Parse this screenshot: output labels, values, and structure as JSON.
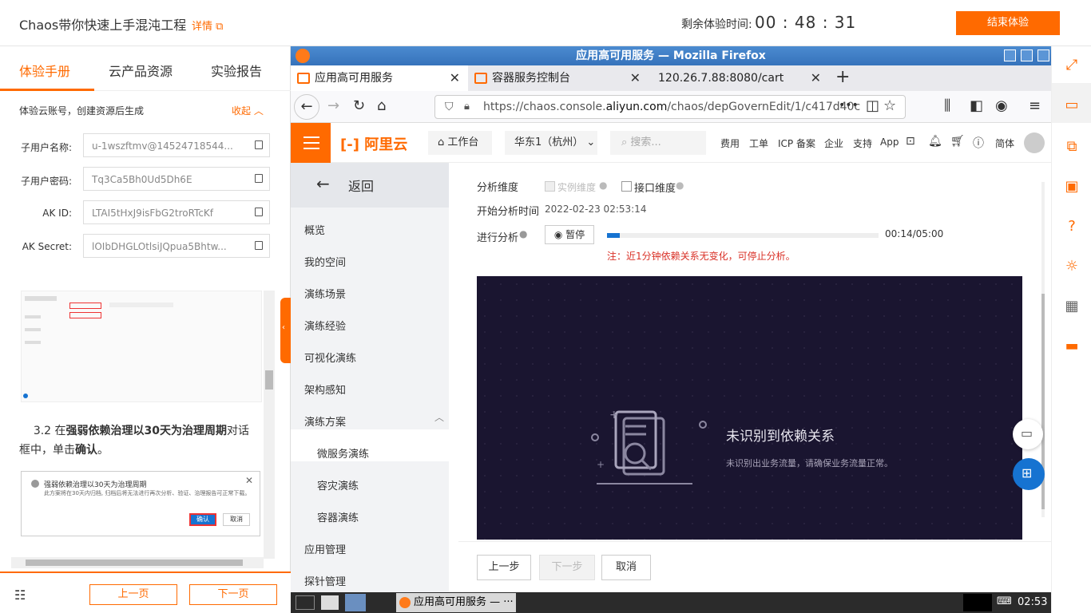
{
  "topbar": {
    "title": "Chaos带你快速上手混沌工程",
    "detail": "详情",
    "timer_label": "剩余体验时间:",
    "timer": "00 : 48 : 31",
    "end_button": "结束体验"
  },
  "left": {
    "tabs": [
      "体验手册",
      "云产品资源",
      "实验报告"
    ],
    "account_heading": "体验云账号，创建资源后生成",
    "collapse": "收起",
    "fields": [
      {
        "label": "子用户名称:",
        "value": "u-1wszftmv@14524718544..."
      },
      {
        "label": "子用户密码:",
        "value": "Tq3Ca5Bh0Ud5Dh6E"
      },
      {
        "label": "AK ID:",
        "value": "LTAI5tHxJ9isFbG2troRTcKf"
      },
      {
        "label": "AK Secret:",
        "value": "lOIbDHGLOtlsiJQpua5Bhtw..."
      }
    ],
    "doc_step": "3.2 在",
    "doc_bold1": "强弱依赖治理以30天为治理周期",
    "doc_mid": "对话框中，单击",
    "doc_bold2": "确认",
    "doc_end": "。",
    "dialog_title": "强弱依赖治理以30天为治理周期",
    "dialog_text": "此方案将在30天内归档, 归档后将无法进行再次分析、验证、治理报告可正常下载。",
    "dialog_confirm": "确认",
    "dialog_cancel": "取消",
    "prev": "上一页",
    "next": "下一页"
  },
  "firefox": {
    "window_title": "应用高可用服务 — Mozilla Firefox",
    "tabs": [
      {
        "label": "应用高可用服务"
      },
      {
        "label": "容器服务控制台"
      },
      {
        "label": "120.26.7.88:8080/cart"
      }
    ],
    "url_prefix": "https://chaos.console.",
    "url_domain": "aliyun.com",
    "url_suffix": "/chaos/depGovernEdit/1/c417d40c"
  },
  "aliyun": {
    "logo": "阿里云",
    "workbench": "工作台",
    "region": "华东1（杭州）",
    "search_placeholder": "搜索...",
    "menu": [
      "费用",
      "工单",
      "ICP 备案",
      "企业",
      "支持",
      "App"
    ],
    "lang": "简体",
    "back": "返回",
    "nav": [
      "概览",
      "我的空间",
      "演练场景",
      "演练经验",
      "可视化演练",
      "架构感知",
      "演练方案"
    ],
    "subnav": [
      "微服务演练",
      "容灾演练",
      "容器演练"
    ],
    "nav_bottom": [
      "应用管理",
      "探针管理"
    ],
    "analysis_dim_label": "分析维度",
    "dim_instance": "实例维度",
    "dim_interface": "接口维度",
    "start_time_label": "开始分析时间",
    "start_time": "2022-02-23 02:53:14",
    "progress_label": "进行分析",
    "pause": "暂停",
    "progress_time": "00:14/05:00",
    "progress_fraction": 0.047,
    "warning": "注：近1分钟依赖关系无变化，可停止分析。",
    "empty_title": "未识别到依赖关系",
    "empty_sub": "未识别出业务流量，请确保业务流量正常。",
    "prev_step": "上一步",
    "next_step": "下一步",
    "cancel": "取消"
  },
  "taskbar": {
    "app": "应用高可用服务 — ···",
    "clock": "02:53"
  }
}
